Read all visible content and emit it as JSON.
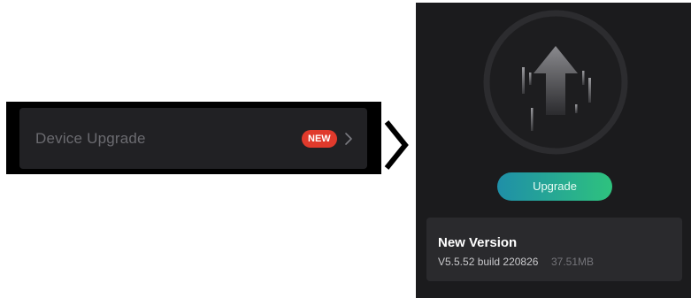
{
  "settings_row": {
    "label": "Device Upgrade",
    "badge": "NEW",
    "chevron_icon": "chevron-right-icon"
  },
  "transition_icon": "chevron-right-icon",
  "upgrade_screen": {
    "hero_icon": "upload-arrow-icon",
    "button_label": "Upgrade",
    "info": {
      "title": "New Version",
      "version": "V5.5.52 build 220826",
      "size": "37.51MB"
    }
  },
  "colors": {
    "badge": "#e03a2c",
    "button_gradient_start": "#1f8fa8",
    "button_gradient_end": "#2ec27e",
    "panel_background": "#1b1b1d",
    "card_background": "#2a2a2d"
  }
}
